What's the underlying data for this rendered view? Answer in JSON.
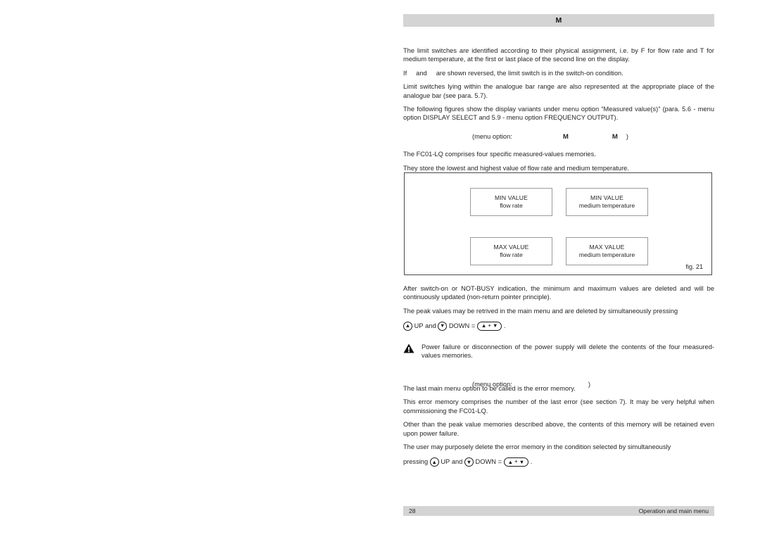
{
  "header": {
    "title": "M"
  },
  "body": {
    "paragraphs": [
      "The limit switches are identified according to their physical assignment, i.e. by F for flow rate and T for medium temperature, at the first or last place of the second line on the display.",
      "Limit switches lying within the analogue bar range are also represented at the appropriate place of the analogue bar (see para. 5.7).",
      "The following figures show the display variants under menu option “Measured value(s)” (para. 5.6 - menu option DISPLAY SELECT and 5.9 - menu option FREQUENCY OUTPUT).",
      "The FC01-LQ comprises four specific measured-values memories.",
      "They store the lowest and highest value of flow rate and medium temperature."
    ],
    "reversed_line": {
      "part1": "If",
      "part2": "and",
      "part3": "are shown reversed, the limit switch is in the switch-on condition."
    }
  },
  "menu_option_1": {
    "open": "(menu option:",
    "label_1": "M",
    "label_2": "M",
    "close": ")"
  },
  "menu_option_2": {
    "open": "(menu option:",
    "close": ")"
  },
  "figure": {
    "caption": "fig. 21",
    "boxes": [
      {
        "line1": "MIN VALUE",
        "line2": "flow rate"
      },
      {
        "line1": "MIN VALUE",
        "line2": "medium temperature"
      },
      {
        "line1": "MAX VALUE",
        "line2": "flow rate"
      },
      {
        "line1": "MAX VALUE",
        "line2": "medium temperature"
      }
    ]
  },
  "after_figure": {
    "paragraphs": [
      "After switch-on or NOT-BUSY indication, the minimum and maximum values are deleted and will be continuously updated (non-return pointer principle).",
      "The peak values may be retrived in the main menu and are deleted by simultaneously pressing"
    ],
    "keys_line": {
      "up_label": "UP",
      "and_label": "and",
      "down_label": "DOWN",
      "equals": "=",
      "up_glyph": "▲",
      "down_glyph": "▼",
      "plus": "+",
      "period": "."
    }
  },
  "warning": {
    "text": "Power failure or disconnection of the power supply will delete the contents of the four measured-values memories."
  },
  "tail": {
    "paragraphs": [
      "The last main menu option to be called is the error memory.",
      "This error memory comprises the number of the last error (see section 7). It may be very helpful when commissioning the FC01-LQ.",
      "Other than the peak value memories described above, the contents of this memory will be retained even upon power failure.",
      "The user may purposely delete the error memory in the condition selected by simultaneously"
    ],
    "keys_line": {
      "pressing_label": "pressing",
      "up_label": "UP",
      "and_label": "and",
      "down_label": "DOWN",
      "equals": "=",
      "up_glyph": "▲",
      "down_glyph": "▼",
      "plus": "+",
      "period": "."
    }
  },
  "footer": {
    "page_number": "28",
    "section": "Operation and main menu"
  },
  "colors": {
    "bar_grey": "#d4d4d4",
    "text": "#262626",
    "figure_border": "#4a4a4a",
    "box_border": "#9a9a9a"
  }
}
